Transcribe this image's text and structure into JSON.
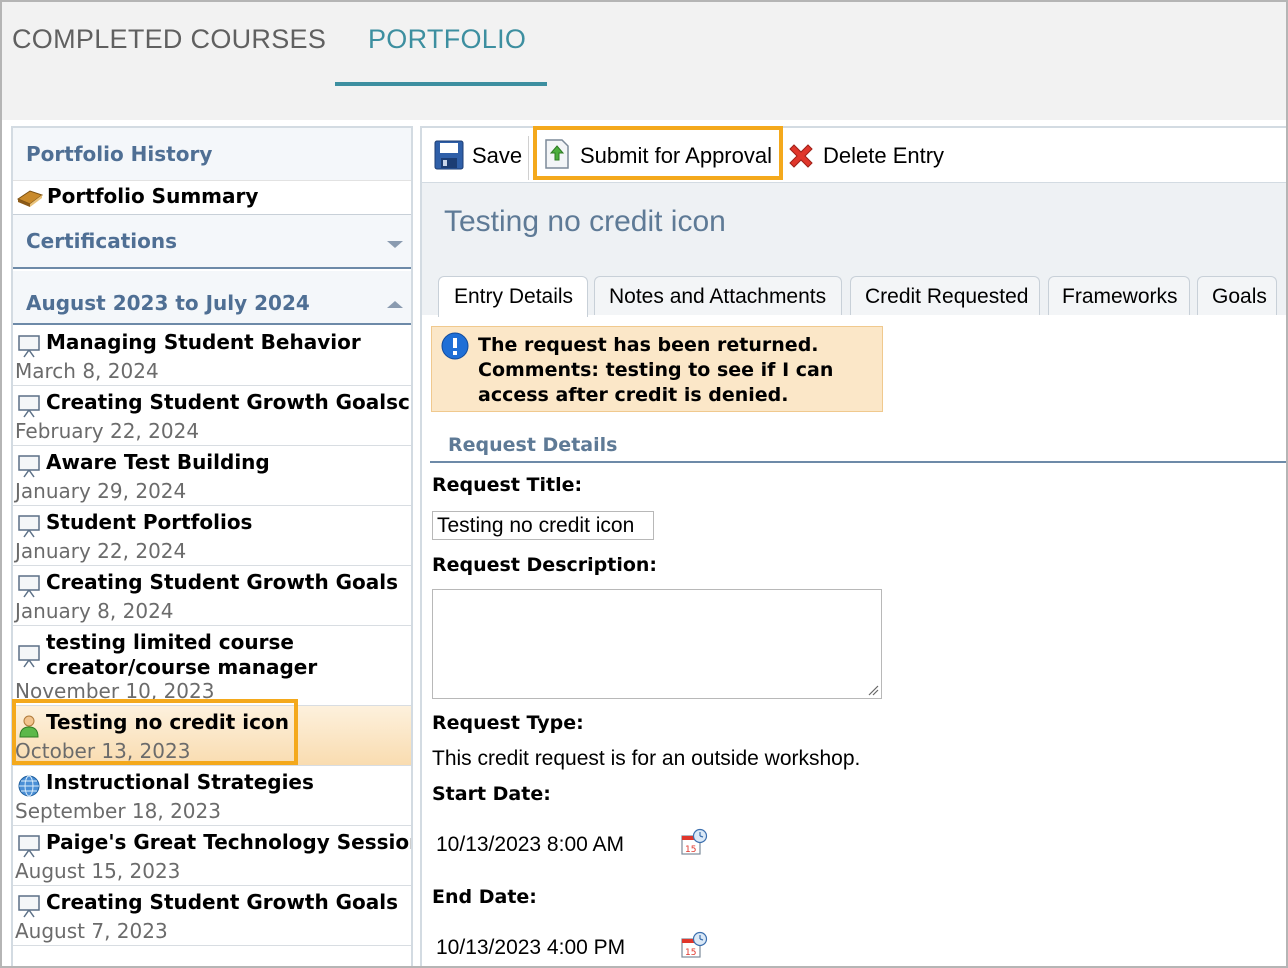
{
  "top_tabs": {
    "completed": "COMPLETED COURSES",
    "portfolio": "PORTFOLIO"
  },
  "left_panel": {
    "history_header": "Portfolio History",
    "summary_label": "Portfolio Summary",
    "certifications_header": "Certifications",
    "range_header": "August 2023 to July 2024",
    "items": [
      {
        "title": "Managing Student Behavior",
        "date": "March 8, 2024",
        "icon": "presentation-icon"
      },
      {
        "title": "Creating Student Growth Goalsc",
        "date": "February 22, 2024",
        "icon": "presentation-icon"
      },
      {
        "title": "Aware Test Building",
        "date": "January 29, 2024",
        "icon": "presentation-icon"
      },
      {
        "title": "Student Portfolios",
        "date": "January 22, 2024",
        "icon": "presentation-icon"
      },
      {
        "title": "Creating Student Growth Goals",
        "date": "January 8, 2024",
        "icon": "presentation-icon"
      },
      {
        "title_line1": "testing limited course",
        "title_line2": "creator/course manager",
        "date": "November 10, 2023",
        "icon": "presentation-icon"
      },
      {
        "title": "Testing no credit icon",
        "date": "October 13, 2023",
        "icon": "person-icon"
      },
      {
        "title": "Instructional Strategies",
        "date": "September 18, 2023",
        "icon": "globe-icon"
      },
      {
        "title": "Paige's Great Technology Session",
        "date": "August 15, 2023",
        "icon": "presentation-icon"
      },
      {
        "title": "Creating Student Growth Goals",
        "date": "August 7, 2023",
        "icon": "presentation-icon"
      }
    ]
  },
  "toolbar": {
    "save": "Save",
    "submit": "Submit for Approval",
    "delete": "Delete Entry"
  },
  "entry": {
    "title": "Testing no credit icon",
    "tabs": [
      "Entry Details",
      "Notes and Attachments",
      "Credit Requested",
      "Frameworks",
      "Goals"
    ],
    "alert_line1": "The request has been returned.",
    "alert_line2": "Comments: testing to see if I can",
    "alert_line3": "access after credit is denied.",
    "section_header": "Request Details",
    "request_title_label": "Request Title:",
    "request_title_value": "Testing no credit icon",
    "request_description_label": "Request Description:",
    "request_type_label": "Request Type:",
    "request_type_value": "This credit request is for an outside workshop.",
    "start_date_label": "Start Date:",
    "start_date_value": "10/13/2023 8:00 AM",
    "end_date_label": "End Date:",
    "end_date_value": "10/13/2023 4:00 PM"
  },
  "colors": {
    "accent": "#3d8fa0",
    "highlight": "#f4a91c",
    "header_text": "#4f6f94",
    "alert_bg": "#fbe7c8"
  }
}
